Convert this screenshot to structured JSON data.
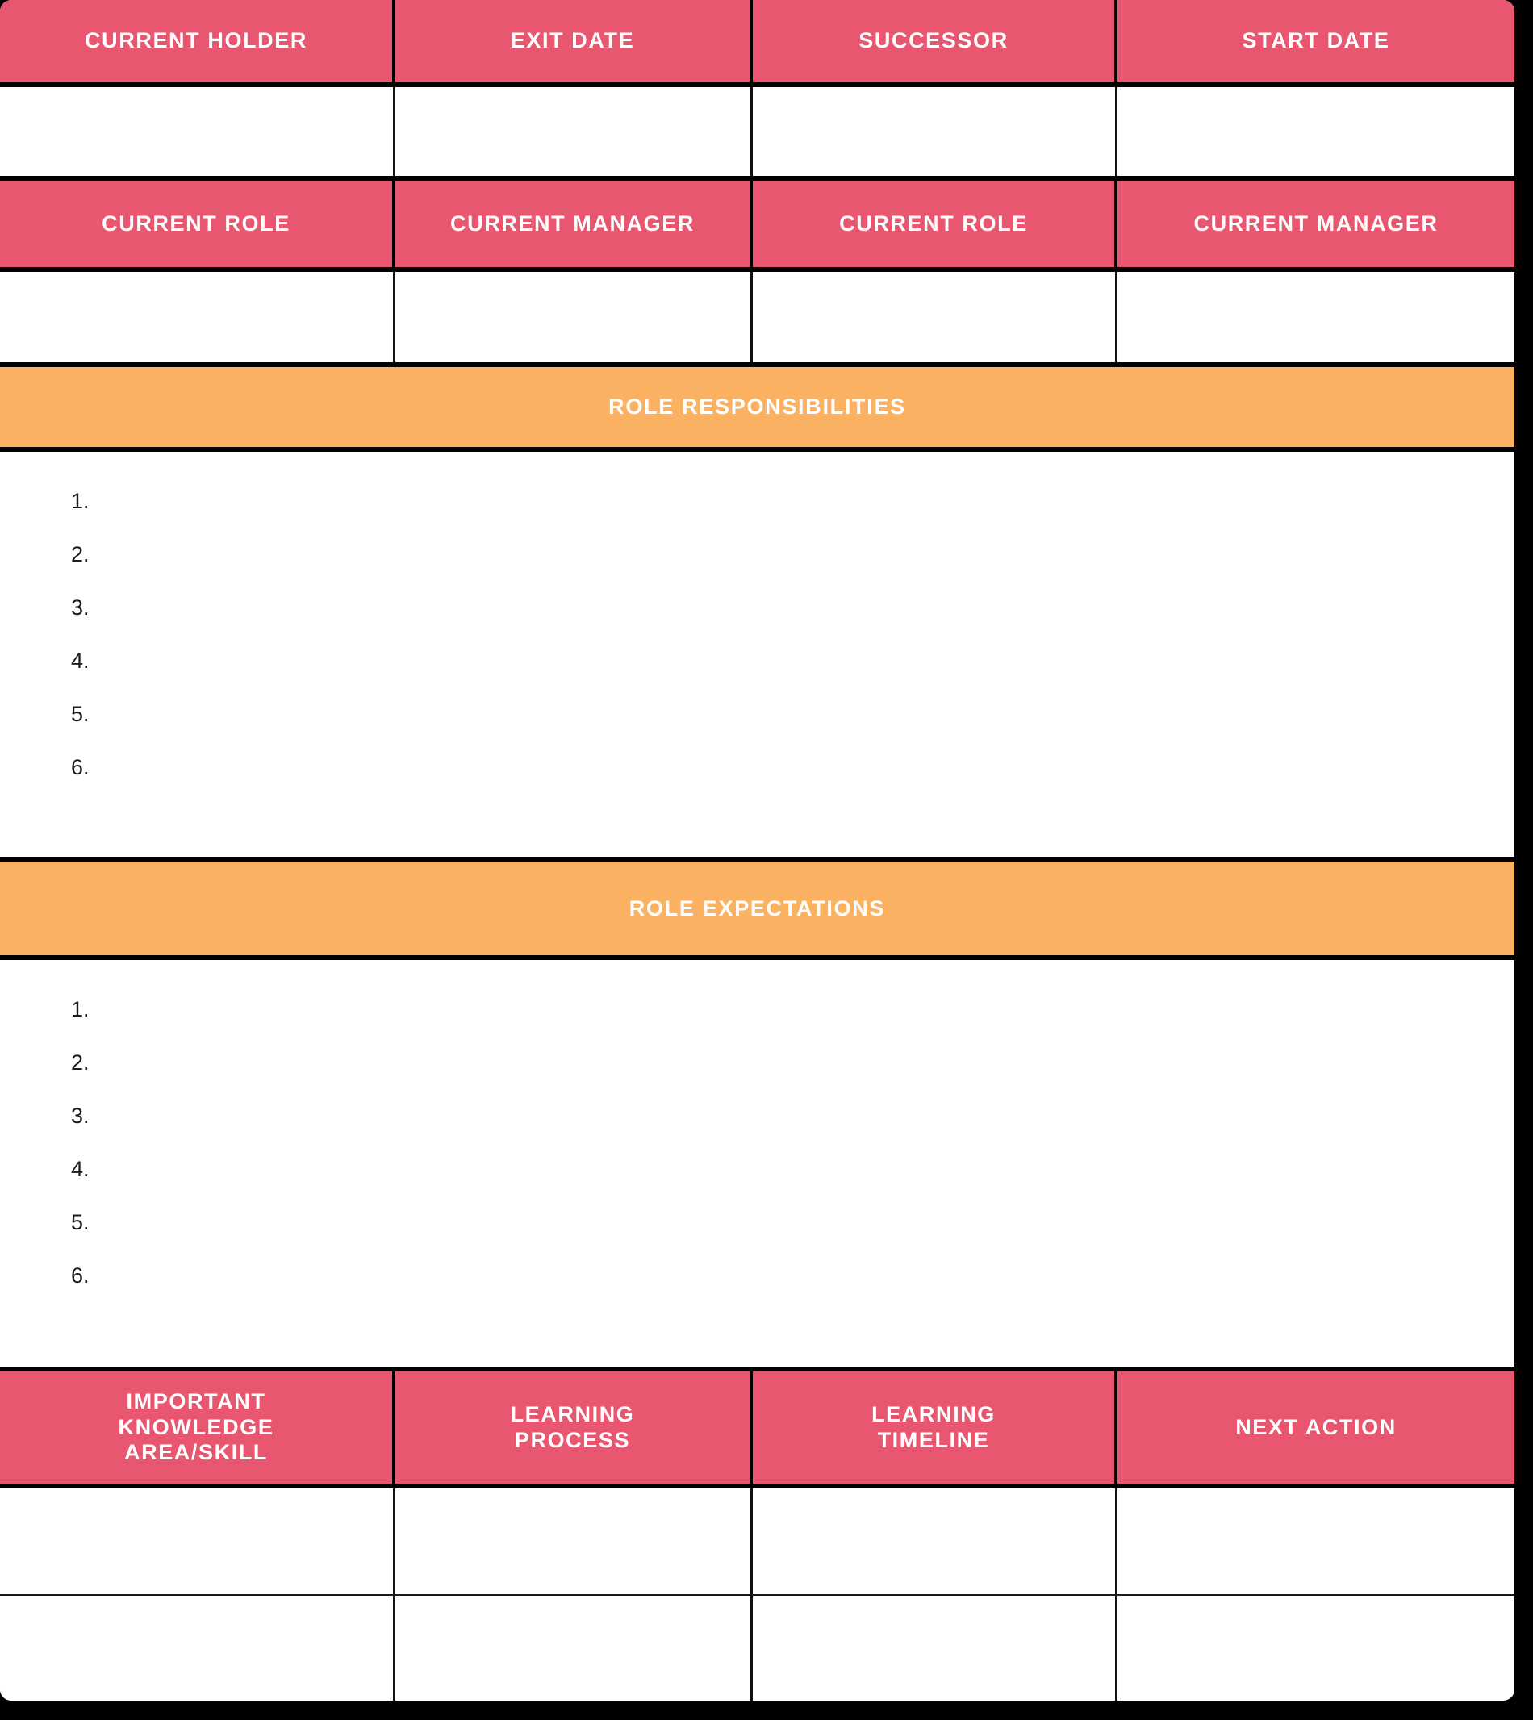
{
  "document": {
    "type": "succession-planning-worksheet",
    "colors": {
      "header_pink": "#E8566F",
      "section_orange": "#FBB162",
      "border_black": "#000000",
      "cell_white": "#FFFFFF",
      "header_text": "#FFFFFF",
      "body_text": "#1C1C1C"
    }
  },
  "row_headers_1": {
    "cells": [
      {
        "label": "CURRENT HOLDER",
        "value": ""
      },
      {
        "label": "EXIT DATE",
        "value": ""
      },
      {
        "label": "SUCCESSOR",
        "value": ""
      },
      {
        "label": "START DATE",
        "value": ""
      }
    ]
  },
  "row_headers_2": {
    "cells": [
      {
        "label": "CURRENT ROLE",
        "value": ""
      },
      {
        "label": "CURRENT MANAGER",
        "value": ""
      },
      {
        "label": "CURRENT ROLE",
        "value": ""
      },
      {
        "label": "CURRENT MANAGER",
        "value": ""
      }
    ]
  },
  "responsibilities": {
    "banner": "ROLE RESPONSIBILITIES",
    "items": [
      {
        "number": "1.",
        "text": ""
      },
      {
        "number": "2.",
        "text": ""
      },
      {
        "number": "3.",
        "text": ""
      },
      {
        "number": "4.",
        "text": ""
      },
      {
        "number": "5.",
        "text": ""
      },
      {
        "number": "6.",
        "text": ""
      }
    ]
  },
  "expectations": {
    "banner": "ROLE EXPECTATIONS",
    "items": [
      {
        "number": "1.",
        "text": ""
      },
      {
        "number": "2.",
        "text": ""
      },
      {
        "number": "3.",
        "text": ""
      },
      {
        "number": "4.",
        "text": ""
      },
      {
        "number": "5.",
        "text": ""
      },
      {
        "number": "6.",
        "text": ""
      }
    ]
  },
  "learning_table": {
    "headers": [
      "IMPORTANT\nKNOWLEDGE\nAREA/SKILL",
      "LEARNING\nPROCESS",
      "LEARNING\nTIMELINE",
      "NEXT ACTION"
    ],
    "rows": [
      {
        "cells": [
          "",
          "",
          "",
          ""
        ]
      },
      {
        "cells": [
          "",
          "",
          "",
          ""
        ]
      }
    ]
  }
}
